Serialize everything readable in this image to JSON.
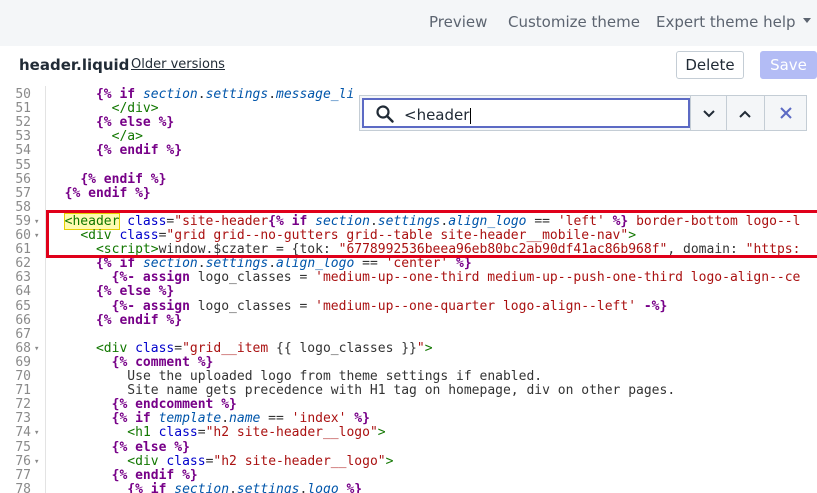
{
  "topbar": {
    "preview": "Preview",
    "customize": "Customize theme",
    "expert": "Expert theme help"
  },
  "file": {
    "name": "header.liquid",
    "older_versions": "Older versions",
    "delete": "Delete",
    "save": "Save"
  },
  "search": {
    "value": "<header",
    "icons": [
      "search-icon",
      "chevron-down-icon",
      "chevron-up-icon",
      "close-icon"
    ]
  },
  "colors": {
    "accent": "#5c6ac4",
    "save_disabled": "#b3bcf5",
    "highlight_box": "#e0001a"
  },
  "lines": [
    {
      "n": "50",
      "fold": "",
      "indent": 6,
      "tokens": [
        [
          "kw",
          "{%"
        ],
        [
          "kw",
          " if "
        ],
        [
          "var",
          "section"
        ],
        [
          "plain",
          "."
        ],
        [
          "var",
          "settings"
        ],
        [
          "plain",
          "."
        ],
        [
          "var",
          "message_li"
        ]
      ]
    },
    {
      "n": "51",
      "fold": "",
      "indent": 8,
      "tokens": [
        [
          "tag",
          "</div>"
        ]
      ]
    },
    {
      "n": "52",
      "fold": "",
      "indent": 6,
      "tokens": [
        [
          "kw",
          "{% else %}"
        ]
      ]
    },
    {
      "n": "53",
      "fold": "",
      "indent": 8,
      "tokens": [
        [
          "tag",
          "</a>"
        ]
      ]
    },
    {
      "n": "54",
      "fold": "",
      "indent": 6,
      "tokens": [
        [
          "kw",
          "{% endif %}"
        ]
      ]
    },
    {
      "n": "55",
      "fold": "",
      "indent": 0,
      "tokens": []
    },
    {
      "n": "56",
      "fold": "",
      "indent": 4,
      "tokens": [
        [
          "kw",
          "{% endif %}"
        ]
      ]
    },
    {
      "n": "57",
      "fold": "",
      "indent": 2,
      "tokens": [
        [
          "kw",
          "{% endif %}"
        ]
      ]
    },
    {
      "n": "58",
      "fold": "",
      "indent": 0,
      "tokens": []
    },
    {
      "n": "59",
      "fold": "▾",
      "indent": 2,
      "tokens": [
        [
          "hl",
          "<header"
        ],
        [
          "attr",
          " class"
        ],
        [
          "plain",
          "="
        ],
        [
          "str",
          "\"site-header"
        ],
        [
          "kw",
          "{%"
        ],
        [
          "kw",
          " if "
        ],
        [
          "var",
          "section"
        ],
        [
          "plain",
          "."
        ],
        [
          "var",
          "settings"
        ],
        [
          "plain",
          "."
        ],
        [
          "var",
          "align_logo"
        ],
        [
          "plain",
          " == "
        ],
        [
          "str",
          "'left'"
        ],
        [
          "kw",
          " %}"
        ],
        [
          "str",
          " border-bottom logo--l"
        ]
      ]
    },
    {
      "n": "60",
      "fold": "▾",
      "indent": 4,
      "tokens": [
        [
          "tag",
          "<div"
        ],
        [
          "attr",
          " class"
        ],
        [
          "plain",
          "="
        ],
        [
          "str",
          "\"grid grid--no-gutters grid--table site-header__mobile-nav\""
        ],
        [
          "tag",
          ">"
        ]
      ]
    },
    {
      "n": "61",
      "fold": "",
      "indent": 6,
      "tokens": [
        [
          "tag",
          "<script>"
        ],
        [
          "plain",
          "window."
        ],
        [
          "plain",
          "$czater = {tok: "
        ],
        [
          "str",
          "\"6778992536beea96eb80bc2ab90df41ac86b968f\""
        ],
        [
          "plain",
          ", domain: "
        ],
        [
          "str",
          "\"https:"
        ]
      ]
    },
    {
      "n": "62",
      "fold": "",
      "indent": 6,
      "tokens": [
        [
          "kw",
          "{% if "
        ],
        [
          "var",
          "section"
        ],
        [
          "plain",
          "."
        ],
        [
          "var",
          "settings"
        ],
        [
          "plain",
          "."
        ],
        [
          "var",
          "align_logo"
        ],
        [
          "plain",
          " == "
        ],
        [
          "str",
          "'center'"
        ],
        [
          "kw",
          " %}"
        ]
      ]
    },
    {
      "n": "63",
      "fold": "",
      "indent": 8,
      "tokens": [
        [
          "kw",
          "{%- assign "
        ],
        [
          "plain",
          "logo_classes = "
        ],
        [
          "str",
          "'medium-up--one-third medium-up--push-one-third logo-align--ce"
        ]
      ]
    },
    {
      "n": "64",
      "fold": "",
      "indent": 6,
      "tokens": [
        [
          "kw",
          "{% else %}"
        ]
      ]
    },
    {
      "n": "65",
      "fold": "",
      "indent": 8,
      "tokens": [
        [
          "kw",
          "{%- assign "
        ],
        [
          "plain",
          "logo_classes = "
        ],
        [
          "str",
          "'medium-up--one-quarter logo-align--left'"
        ],
        [
          "kw",
          " -%}"
        ]
      ]
    },
    {
      "n": "66",
      "fold": "",
      "indent": 6,
      "tokens": [
        [
          "kw",
          "{% endif %}"
        ]
      ]
    },
    {
      "n": "67",
      "fold": "",
      "indent": 0,
      "tokens": []
    },
    {
      "n": "68",
      "fold": "▾",
      "indent": 6,
      "tokens": [
        [
          "tag",
          "<div"
        ],
        [
          "attr",
          " class"
        ],
        [
          "plain",
          "="
        ],
        [
          "str",
          "\"grid__item "
        ],
        [
          "plain",
          "{{ logo_classes }}"
        ],
        [
          "str",
          "\""
        ],
        [
          "tag",
          ">"
        ]
      ]
    },
    {
      "n": "69",
      "fold": "",
      "indent": 8,
      "tokens": [
        [
          "kw",
          "{% comment %}"
        ]
      ]
    },
    {
      "n": "70",
      "fold": "",
      "indent": 10,
      "tokens": [
        [
          "plain",
          "Use the uploaded logo from theme settings if enabled."
        ]
      ]
    },
    {
      "n": "71",
      "fold": "",
      "indent": 10,
      "tokens": [
        [
          "plain",
          "Site name gets precedence with H1 tag on homepage, div on other pages."
        ]
      ]
    },
    {
      "n": "72",
      "fold": "",
      "indent": 8,
      "tokens": [
        [
          "kw",
          "{% endcomment %}"
        ]
      ]
    },
    {
      "n": "73",
      "fold": "",
      "indent": 8,
      "tokens": [
        [
          "kw",
          "{% if "
        ],
        [
          "var",
          "template"
        ],
        [
          "plain",
          "."
        ],
        [
          "var",
          "name"
        ],
        [
          "plain",
          " == "
        ],
        [
          "str",
          "'index'"
        ],
        [
          "kw",
          " %}"
        ]
      ]
    },
    {
      "n": "74",
      "fold": "▾",
      "indent": 10,
      "tokens": [
        [
          "tag",
          "<h1"
        ],
        [
          "attr",
          " class"
        ],
        [
          "plain",
          "="
        ],
        [
          "str",
          "\"h2 site-header__logo\""
        ],
        [
          "tag",
          ">"
        ]
      ]
    },
    {
      "n": "75",
      "fold": "",
      "indent": 8,
      "tokens": [
        [
          "kw",
          "{% else %}"
        ]
      ]
    },
    {
      "n": "76",
      "fold": "▾",
      "indent": 10,
      "tokens": [
        [
          "tag",
          "<div"
        ],
        [
          "attr",
          " class"
        ],
        [
          "plain",
          "="
        ],
        [
          "str",
          "\"h2 site-header__logo\""
        ],
        [
          "tag",
          ">"
        ]
      ]
    },
    {
      "n": "77",
      "fold": "",
      "indent": 8,
      "tokens": [
        [
          "kw",
          "{% endif %}"
        ]
      ]
    },
    {
      "n": "78",
      "fold": "",
      "indent": 10,
      "tokens": [
        [
          "kw",
          "{% if "
        ],
        [
          "var",
          "section"
        ],
        [
          "plain",
          "."
        ],
        [
          "var",
          "settings"
        ],
        [
          "plain",
          "."
        ],
        [
          "var",
          "logo"
        ],
        [
          "kw",
          " %}"
        ]
      ]
    }
  ]
}
